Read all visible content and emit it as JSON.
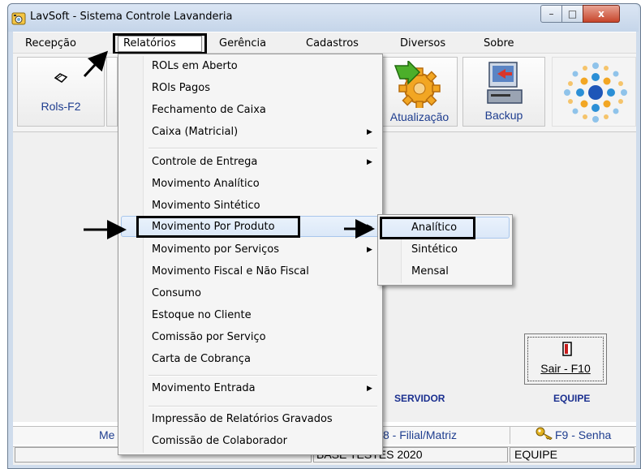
{
  "window": {
    "title": "LavSoft - Sistema Controle Lavanderia",
    "minimize": "–",
    "maximize": "□",
    "close": "x"
  },
  "menubar": [
    "Recepção",
    "Relatórios",
    "Gerência",
    "Cadastros",
    "Diversos",
    "Sobre"
  ],
  "toolbar": {
    "rols_label": "Rols-F2",
    "atualizacao_label": "Atualização",
    "backup_label": "Backup"
  },
  "dropdown": {
    "items": [
      "ROLs em Aberto",
      "ROls Pagos",
      "Fechamento de Caixa",
      "Caixa (Matricial)",
      "Controle de Entrega",
      "Movimento Analítico",
      "Movimento Sintético",
      "Movimento Por Produto",
      "Movimento por Serviços",
      "Movimento Fiscal e Não Fiscal",
      "Consumo",
      "Estoque no Cliente",
      "Comissão por Serviço",
      "Carta de Cobrança",
      "Movimento Entrada",
      "Impressão de Relatórios Gravados",
      "Comissão de Colaborador"
    ],
    "arrow": "▶"
  },
  "submenu": {
    "items": [
      "Analítico",
      "Sintético",
      "Mensal"
    ]
  },
  "main": {
    "sair_label": "Sair - F10",
    "servidor_label": "SERVIDOR",
    "equipe_label": "EQUIPE"
  },
  "bottombar": {
    "left_text": "Me",
    "filial_text": "8 - Filial/Matriz",
    "senha_text": "F9 - Senha"
  },
  "statusbar": {
    "base_text": "BASE TESTES 2020",
    "equipe_text": "EQUIPE"
  },
  "colors": {
    "accent": "#1e3d8f",
    "highlight": "#dbe8f8"
  }
}
